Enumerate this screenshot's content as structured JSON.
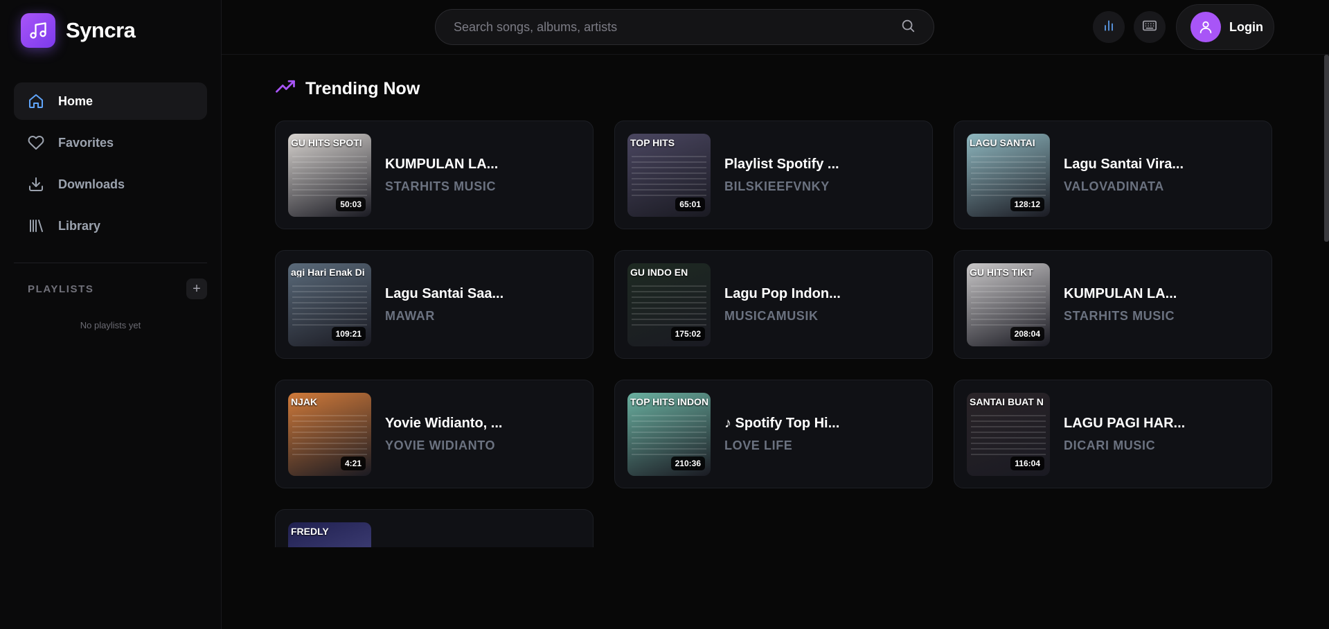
{
  "brand": {
    "name": "Syncra",
    "accent": "#8b5cf6"
  },
  "sidebar": {
    "nav": [
      {
        "label": "Home",
        "icon": "home-icon",
        "active": true
      },
      {
        "label": "Favorites",
        "icon": "heart-icon",
        "active": false
      },
      {
        "label": "Downloads",
        "icon": "download-icon",
        "active": false
      },
      {
        "label": "Library",
        "icon": "library-icon",
        "active": false
      }
    ],
    "playlists": {
      "title": "PLAYLISTS",
      "add": "+",
      "empty": "No playlists yet"
    }
  },
  "header": {
    "search_placeholder": "Search songs, albums, artists",
    "login_label": "Login"
  },
  "section": {
    "title": "Trending Now",
    "icon": "trending-up-icon"
  },
  "tracks": [
    {
      "title": "KUMPULAN LA...",
      "artist": "STARHITS MUSIC",
      "duration": "50:03",
      "thumb_text": "GU HITS SPOTI"
    },
    {
      "title": "Playlist Spotify ...",
      "artist": "BILSKIEEFVNKY",
      "duration": "65:01",
      "thumb_text": "TOP HITS"
    },
    {
      "title": "Lagu Santai Vira...",
      "artist": "VALOVADINATA",
      "duration": "128:12",
      "thumb_text": "LAGU SANTAI"
    },
    {
      "title": "Lagu Santai Saa...",
      "artist": "MAWAR",
      "duration": "109:21",
      "thumb_text": "agi Hari Enak Di"
    },
    {
      "title": "Lagu Pop Indon...",
      "artist": "MUSICAMUSIK",
      "duration": "175:02",
      "thumb_text": "GU INDO EN"
    },
    {
      "title": "KUMPULAN LA...",
      "artist": "STARHITS MUSIC",
      "duration": "208:04",
      "thumb_text": "GU HITS TIKT"
    },
    {
      "title": "Yovie Widianto, ...",
      "artist": "YOVIE WIDIANTO",
      "duration": "4:21",
      "thumb_text": "NJAK"
    },
    {
      "title": "♪ Spotify Top Hi...",
      "artist": "LOVE LIFE",
      "duration": "210:36",
      "thumb_text": "TOP HITS INDONES"
    },
    {
      "title": "LAGU PAGI HAR...",
      "artist": "DICARI MUSIC",
      "duration": "116:04",
      "thumb_text": "SANTAI BUAT N"
    }
  ],
  "partial_track": {
    "thumb_text": "FREDLY"
  },
  "thumb_colors": [
    "#d8d4d0",
    "#4a4660",
    "#8fb8c0",
    "#5a6a7a",
    "#1e2a22",
    "#c9c7c8",
    "#d07a3a",
    "#6ab0a0",
    "#2a2428",
    "#202050"
  ]
}
